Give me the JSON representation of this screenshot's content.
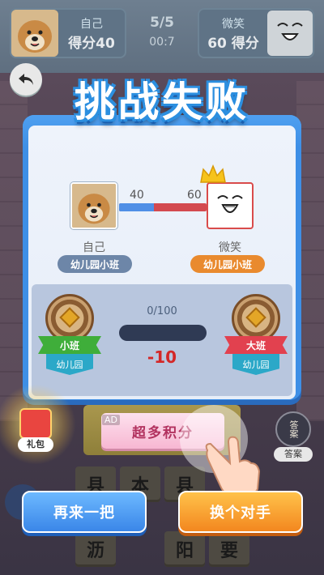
{
  "hud": {
    "self_name": "自己",
    "self_score": "得分40",
    "round": "5/5",
    "timer": "00:7",
    "opp_name": "微笑",
    "opp_score": "60 得分"
  },
  "result": {
    "title": "挑战失败",
    "self": {
      "name": "自己",
      "score": "40",
      "rank": "幼儿园小班"
    },
    "opponent": {
      "name": "微笑",
      "score": "60",
      "rank": "幼儿园小班"
    },
    "score_share_self": 0.4,
    "rank_progress": {
      "label": "0/100",
      "fraction": 0.0,
      "delta": "-10",
      "current": {
        "title": "小班",
        "tier": "幼儿园"
      },
      "next": {
        "title": "大班",
        "tier": "幼儿园"
      }
    }
  },
  "game": {
    "gift_label": "礼包",
    "ad_tag": "AD",
    "ad_button": "超多积分",
    "answer_icon_text": "答案",
    "answer_label": "答案",
    "tiles": [
      "县",
      "本",
      "县",
      "沥",
      "阳",
      "要"
    ]
  },
  "buttons": {
    "retry": "再来一把",
    "change_opponent": "换个对手"
  },
  "colors": {
    "self_blue": "#4f8fe6",
    "opp_red": "#d34a4f",
    "delta_red": "#d42727"
  }
}
